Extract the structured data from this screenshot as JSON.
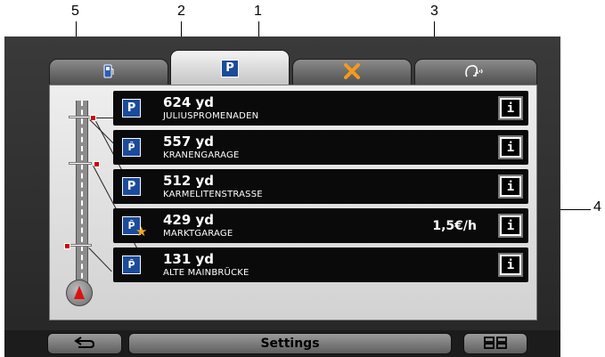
{
  "callouts": [
    "5",
    "2",
    "1",
    "3",
    "4"
  ],
  "tabs": [
    {
      "id": "fuel",
      "icon": "fuel-pump-icon",
      "active": false
    },
    {
      "id": "parking",
      "icon": "parking-icon",
      "label": "P",
      "active": true
    },
    {
      "id": "restaurant",
      "icon": "cutlery-icon",
      "active": false
    },
    {
      "id": "voice",
      "icon": "speaking-head-icon",
      "active": false
    }
  ],
  "list": [
    {
      "distance": "624 yd",
      "name": "JULIUSPROMENADEN",
      "icon": "parking-icon",
      "symbol": "P",
      "price": ""
    },
    {
      "distance": "557 yd",
      "name": "KRANENGARAGE",
      "icon": "parking-garage-icon",
      "symbol": "P̂",
      "price": ""
    },
    {
      "distance": "512 yd",
      "name": "KARMELITENSTRASSE",
      "icon": "parking-icon",
      "symbol": "P",
      "price": ""
    },
    {
      "distance": "429 yd",
      "name": "MARKTGARAGE",
      "icon": "parking-garage-icon",
      "symbol": "P̂",
      "price": "1,5€/h",
      "favorite": true
    },
    {
      "distance": "131 yd",
      "name": "ALTE MAINBRÜCKE",
      "icon": "parking-garage-icon",
      "symbol": "P̂",
      "price": ""
    }
  ],
  "info_label": "i",
  "bottom": {
    "settings_label": "Settings"
  },
  "colors": {
    "parking_blue": "#1b4b9b",
    "marker_red": "#d00000",
    "star": "#f5a623"
  }
}
